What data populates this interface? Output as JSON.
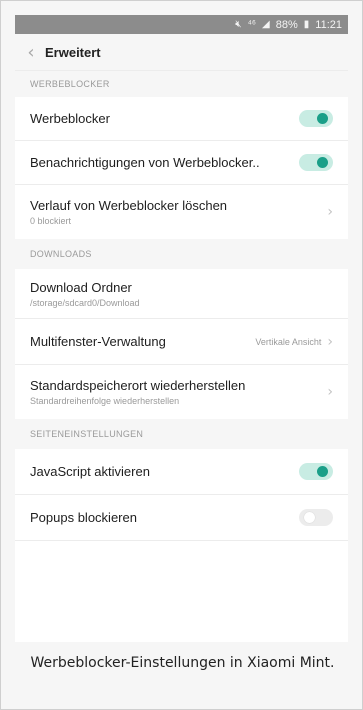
{
  "statusbar": {
    "mute_icon": "mute-icon",
    "network": "⁴⁶",
    "signal": "signal-icon",
    "battery_pct": "88%",
    "battery_icon": "battery-icon",
    "time": "11:21"
  },
  "appbar": {
    "back_icon": "back-chevron-icon",
    "title": "Erweitert"
  },
  "sections": [
    {
      "header": "WERBEBLOCKER"
    },
    {
      "header": "DOWNLOADS"
    },
    {
      "header": "SEITENEINSTELLUNGEN"
    }
  ],
  "rows": {
    "adblock": {
      "title": "Werbeblocker",
      "enabled": true
    },
    "adblock_notify": {
      "title": "Benachrichtigungen von Werbeblocker..",
      "enabled": true
    },
    "adblock_clear": {
      "title": "Verlauf von Werbeblocker löschen",
      "sub": "0 blockiert"
    },
    "download_folder": {
      "title": "Download Ordner",
      "sub": "/storage/sdcard0/Download"
    },
    "multiwindow": {
      "title": "Multifenster-Verwaltung",
      "value": "Vertikale Ansicht"
    },
    "restore_default": {
      "title": "Standardspeicherort wiederherstellen",
      "sub": "Standardreihenfolge wiederherstellen"
    },
    "javascript": {
      "title": "JavaScript aktivieren",
      "enabled": true
    },
    "popups": {
      "title": "Popups blockieren",
      "enabled": false
    }
  },
  "colors": {
    "accent": "#1a9f88",
    "statusbar": "#8c8c8c"
  },
  "caption": "Werbeblocker-Einstellungen in Xiaomi Mint."
}
